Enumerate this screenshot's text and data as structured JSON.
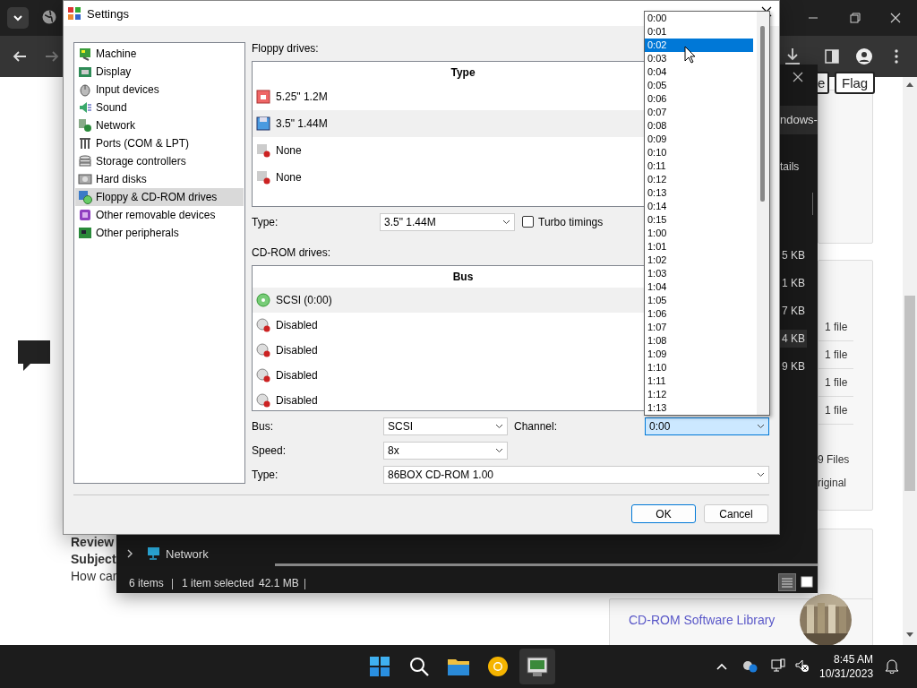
{
  "browser": {
    "page": {
      "buttons": [
        "e",
        "Flag"
      ],
      "side_texts": [
        {
          "text": "Review",
          "bold": true
        },
        {
          "text": "Subject",
          "bold": true
        },
        {
          "text": "How car",
          "bold": false
        }
      ],
      "file_counts": [
        "1 file",
        "1 file",
        "1 file",
        "1 file"
      ],
      "files_total": "9 Files",
      "original_label": "riginal",
      "link": "CD-ROM Software Library",
      "thumbnail": {
        "kind": "picture"
      }
    }
  },
  "explorer": {
    "path": "ndows-",
    "toolbar_label": "tails",
    "sizes": [
      {
        "text": "5 KB",
        "selected": false
      },
      {
        "text": "1 KB",
        "selected": false
      },
      {
        "text": "7 KB",
        "selected": false
      },
      {
        "text": "4 KB",
        "selected": true
      },
      {
        "text": "9 KB",
        "selected": false
      }
    ],
    "nav_item": "Network",
    "status": {
      "items": "6 items",
      "selection": "1 item selected",
      "size": "42.1 MB"
    },
    "views": [
      {
        "kind": "details",
        "selected": true
      },
      {
        "kind": "tiles",
        "selected": false
      }
    ]
  },
  "settings": {
    "title": "Settings",
    "categories": [
      {
        "label": "Machine",
        "selected": false
      },
      {
        "label": "Display",
        "selected": false
      },
      {
        "label": "Input devices",
        "selected": false
      },
      {
        "label": "Sound",
        "selected": false
      },
      {
        "label": "Network",
        "selected": false
      },
      {
        "label": "Ports (COM & LPT)",
        "selected": false
      },
      {
        "label": "Storage controllers",
        "selected": false
      },
      {
        "label": "Hard disks",
        "selected": false
      },
      {
        "label": "Floppy & CD-ROM drives",
        "selected": true
      },
      {
        "label": "Other removable devices",
        "selected": false
      },
      {
        "label": "Other peripherals",
        "selected": false
      }
    ],
    "floppy": {
      "label": "Floppy drives:",
      "column": "Type",
      "drives": [
        {
          "label": "5.25\" 1.2M",
          "kind": "floppy525",
          "selected": false
        },
        {
          "label": "3.5\" 1.44M",
          "kind": "floppy35",
          "selected": true
        },
        {
          "label": "None",
          "kind": "none",
          "selected": false
        },
        {
          "label": "None",
          "kind": "none",
          "selected": false
        }
      ],
      "type_label": "Type:",
      "type_value": "3.5\" 1.44M",
      "turbo": {
        "label": "Turbo timings",
        "checked": false
      }
    },
    "cdrom": {
      "label": "CD-ROM drives:",
      "column": "Bus",
      "drives": [
        {
          "label": "SCSI (0:00)",
          "kind": "cd",
          "selected": true
        },
        {
          "label": "Disabled",
          "kind": "disabled",
          "selected": false
        },
        {
          "label": "Disabled",
          "kind": "disabled",
          "selected": false
        },
        {
          "label": "Disabled",
          "kind": "disabled",
          "selected": false
        },
        {
          "label": "Disabled",
          "kind": "disabled",
          "selected": false
        }
      ],
      "bus_label": "Bus:",
      "bus_value": "SCSI",
      "channel_label": "Channel:",
      "channel_value": "0:00",
      "speed_label": "Speed:",
      "speed_value": "8x",
      "type_label": "Type:",
      "type_value": "86BOX CD-ROM 1.00"
    },
    "channel_list": [
      {
        "label": "0:00",
        "selected": false
      },
      {
        "label": "0:01",
        "selected": false
      },
      {
        "label": "0:02",
        "selected": true
      },
      {
        "label": "0:03",
        "selected": false
      },
      {
        "label": "0:04",
        "selected": false
      },
      {
        "label": "0:05",
        "selected": false
      },
      {
        "label": "0:06",
        "selected": false
      },
      {
        "label": "0:07",
        "selected": false
      },
      {
        "label": "0:08",
        "selected": false
      },
      {
        "label": "0:09",
        "selected": false
      },
      {
        "label": "0:10",
        "selected": false
      },
      {
        "label": "0:11",
        "selected": false
      },
      {
        "label": "0:12",
        "selected": false
      },
      {
        "label": "0:13",
        "selected": false
      },
      {
        "label": "0:14",
        "selected": false
      },
      {
        "label": "0:15",
        "selected": false
      },
      {
        "label": "1:00",
        "selected": false
      },
      {
        "label": "1:01",
        "selected": false
      },
      {
        "label": "1:02",
        "selected": false
      },
      {
        "label": "1:03",
        "selected": false
      },
      {
        "label": "1:04",
        "selected": false
      },
      {
        "label": "1:05",
        "selected": false
      },
      {
        "label": "1:06",
        "selected": false
      },
      {
        "label": "1:07",
        "selected": false
      },
      {
        "label": "1:08",
        "selected": false
      },
      {
        "label": "1:09",
        "selected": false
      },
      {
        "label": "1:10",
        "selected": false
      },
      {
        "label": "1:11",
        "selected": false
      },
      {
        "label": "1:12",
        "selected": false
      },
      {
        "label": "1:13",
        "selected": false
      }
    ],
    "buttons": [
      {
        "label": "OK",
        "default": true
      },
      {
        "label": "Cancel",
        "default": false
      }
    ]
  },
  "taskbar": {
    "apps": [
      {
        "kind": "start",
        "selected": false
      },
      {
        "kind": "search",
        "selected": false
      },
      {
        "kind": "files",
        "selected": false
      },
      {
        "kind": "browser",
        "selected": false
      },
      {
        "kind": "emulator",
        "selected": true
      }
    ],
    "clock": {
      "time": "8:45 AM",
      "date": "10/31/2023"
    }
  }
}
